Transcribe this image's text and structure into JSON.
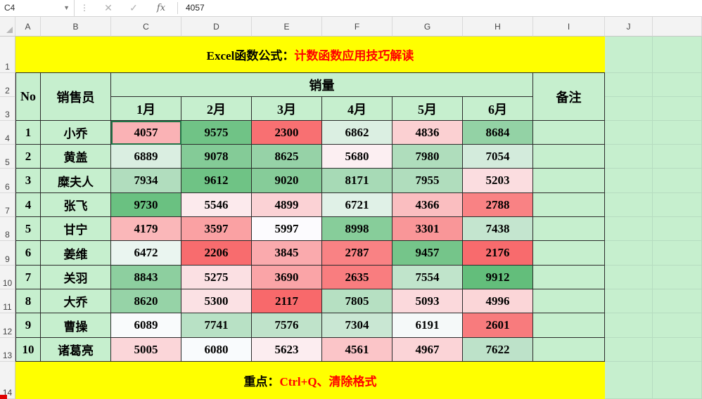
{
  "formula_bar": {
    "name_box": "C4",
    "formula_value": "4057",
    "fx": "fx"
  },
  "columns": [
    "A",
    "B",
    "C",
    "D",
    "E",
    "F",
    "G",
    "H",
    "I",
    "J"
  ],
  "rows": [
    "1",
    "2",
    "3",
    "4",
    "5",
    "6",
    "7",
    "8",
    "9",
    "10",
    "11",
    "12",
    "13",
    "14"
  ],
  "sheet": {
    "title_black": "Excel函数公式：",
    "title_red": "计数函数应用技巧解读",
    "header_no": "No",
    "header_seller": "销售员",
    "header_sales": "销量",
    "header_note": "备注",
    "months": [
      "1月",
      "2月",
      "3月",
      "4月",
      "5月",
      "6月"
    ],
    "records": [
      {
        "no": "1",
        "name": "小乔",
        "sales": [
          "4057",
          "9575",
          "2300",
          "6862",
          "4836",
          "8684"
        ]
      },
      {
        "no": "2",
        "name": "黄盖",
        "sales": [
          "6889",
          "9078",
          "8625",
          "5680",
          "7980",
          "7054"
        ]
      },
      {
        "no": "3",
        "name": "糜夫人",
        "sales": [
          "7934",
          "9612",
          "9020",
          "8171",
          "7955",
          "5203"
        ]
      },
      {
        "no": "4",
        "name": "张飞",
        "sales": [
          "9730",
          "5546",
          "4899",
          "6721",
          "4366",
          "2788"
        ]
      },
      {
        "no": "5",
        "name": "甘宁",
        "sales": [
          "4179",
          "3597",
          "5997",
          "8998",
          "3301",
          "7438"
        ]
      },
      {
        "no": "6",
        "name": "姜维",
        "sales": [
          "6472",
          "2206",
          "3845",
          "2787",
          "9457",
          "2176"
        ]
      },
      {
        "no": "7",
        "name": "关羽",
        "sales": [
          "8843",
          "5275",
          "3690",
          "2635",
          "7554",
          "9912"
        ]
      },
      {
        "no": "8",
        "name": "大乔",
        "sales": [
          "8620",
          "5300",
          "2117",
          "7805",
          "5093",
          "4996"
        ]
      },
      {
        "no": "9",
        "name": "曹操",
        "sales": [
          "6089",
          "7741",
          "7576",
          "7304",
          "6191",
          "2601"
        ]
      },
      {
        "no": "10",
        "name": "诸葛亮",
        "sales": [
          "5005",
          "6080",
          "5623",
          "4561",
          "4967",
          "7622"
        ]
      }
    ],
    "footer_black": "重点：",
    "footer_red": "Ctrl+Q、清除格式"
  },
  "colors": {
    "sheet_bg": "#c6efce",
    "banner_bg": "#ffff00",
    "accent_red": "#ff0000",
    "scale_low": "#f8696b",
    "scale_mid": "#fcfcff",
    "scale_high": "#63be7b"
  }
}
